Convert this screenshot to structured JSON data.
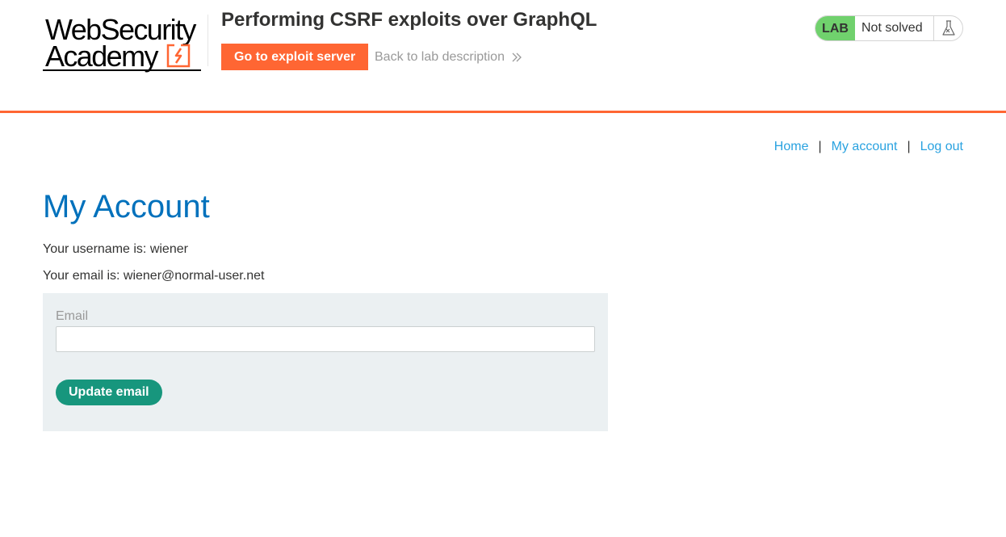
{
  "header": {
    "logo": {
      "line1": "WebSecurity",
      "line2": "Academy"
    },
    "lab_title": "Performing CSRF exploits over GraphQL",
    "exploit_button_label": "Go to exploit server",
    "back_link_label": "Back to lab description",
    "status": {
      "badge": "LAB",
      "text": "Not solved",
      "icon": "flask-icon"
    },
    "accent_color": "#ff6633"
  },
  "nav": {
    "home": "Home",
    "separator": "|",
    "my_account": "My account",
    "log_out": "Log out"
  },
  "main": {
    "title": "My Account",
    "username_line": "Your username is: wiener",
    "email_line": "Your email is: wiener@normal-user.net",
    "form": {
      "email_label": "Email",
      "email_value": "",
      "email_placeholder": "",
      "submit_label": "Update email"
    }
  },
  "colors": {
    "link": "#29a2e0",
    "title": "#0071bc",
    "lab_badge": "#70d16d",
    "update_button": "#17967d",
    "form_background": "#ebf0f2"
  }
}
